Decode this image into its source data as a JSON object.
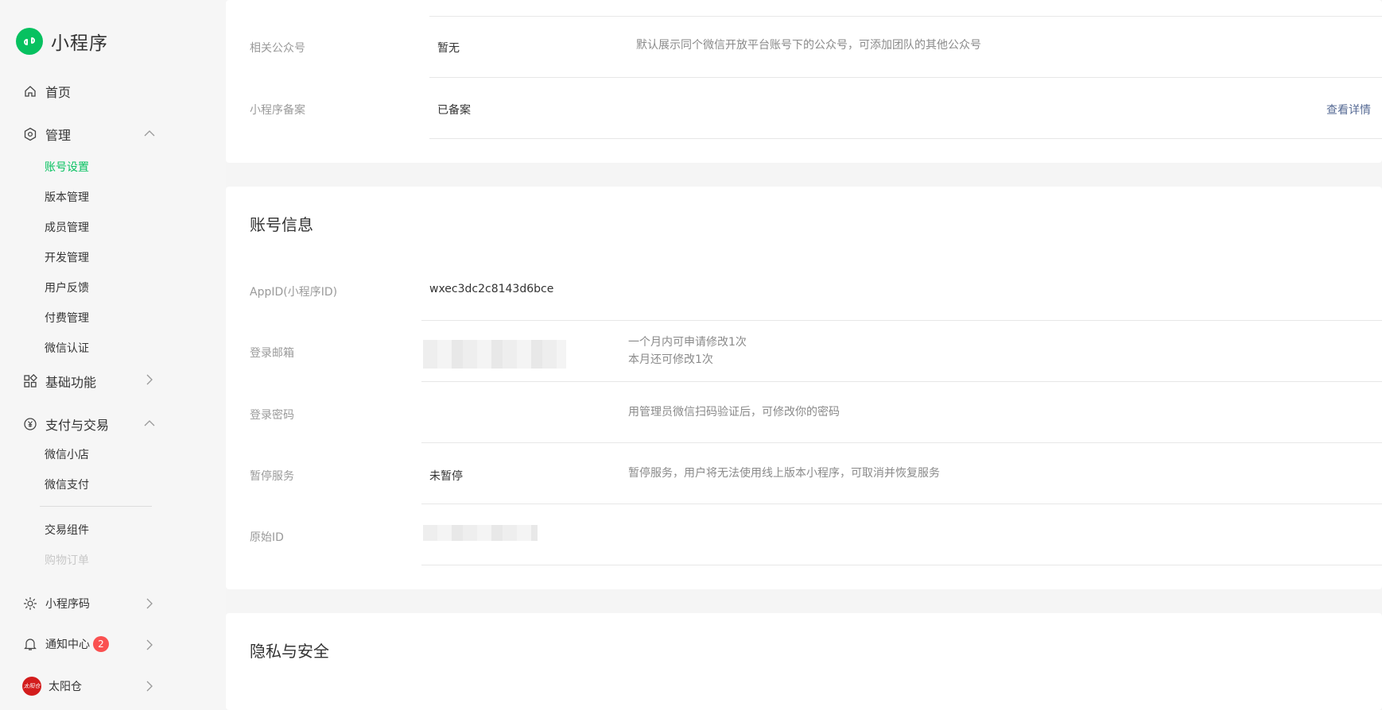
{
  "app": {
    "title": "小程序"
  },
  "sidebar": {
    "home": "首页",
    "manage": "管理",
    "manage_items": [
      "账号设置",
      "版本管理",
      "成员管理",
      "开发管理",
      "用户反馈",
      "付费管理",
      "微信认证"
    ],
    "basic": "基础功能",
    "pay": "支付与交易",
    "pay_items": [
      "微信小店",
      "微信支付"
    ],
    "pay_items2": [
      "交易组件",
      "购物订单"
    ],
    "qrcode": "小程序码",
    "notify": "通知中心",
    "notify_count": "2",
    "user_name": "太阳仓",
    "avatar_text": "太阳仓"
  },
  "top_card": {
    "rows": [
      {
        "label": "相关公众号",
        "value": "暂无",
        "desc": "默认展示同个微信开放平台账号下的公众号，可添加团队的其他公众号"
      },
      {
        "label": "小程序备案",
        "value": "已备案",
        "link": "查看详情"
      }
    ]
  },
  "account_card": {
    "title": "账号信息",
    "appid_label": "AppID(小程序ID)",
    "appid_value": "wxec3dc2c8143d6bce",
    "email_label": "登录邮箱",
    "email_desc1": "一个月内可申请修改1次",
    "email_desc2": "本月还可修改1次",
    "password_label": "登录密码",
    "password_desc": "用管理员微信扫码验证后，可修改你的密码",
    "pause_label": "暂停服务",
    "pause_value": "未暂停",
    "pause_desc": "暂停服务，用户将无法使用线上版本小程序，可取消并恢复服务",
    "origin_label": "原始ID"
  },
  "privacy_card": {
    "title": "隐私与安全"
  },
  "colors": {
    "accent": "#07c160",
    "link": "#576b95",
    "badge": "#fa5151"
  }
}
